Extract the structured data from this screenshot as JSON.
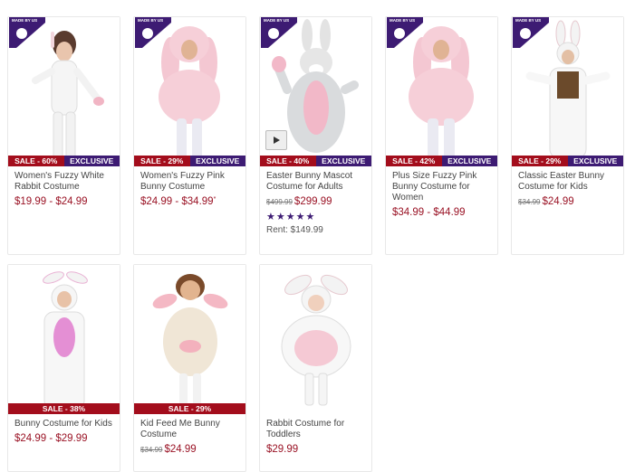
{
  "products": [
    {
      "title": "Women's Fuzzy White Rabbit Costume",
      "sale": "SALE - 60%",
      "exclusive": "EXCLUSIVE",
      "old_price": "",
      "price": "$19.99 - $24.99",
      "made_by_us": "MADE BY US"
    },
    {
      "title": "Women's Fuzzy Pink Bunny Costume",
      "sale": "SALE - 29%",
      "exclusive": "EXCLUSIVE",
      "old_price": "",
      "price": "$24.99 - $34.99",
      "price_mark": "*",
      "made_by_us": "MADE BY US"
    },
    {
      "title": "Easter Bunny Mascot Costume for Adults",
      "sale": "SALE - 40%",
      "exclusive": "EXCLUSIVE",
      "old_price": "$499.99",
      "price": "$299.99",
      "rating": "★★★★★",
      "rent": "Rent: $149.99",
      "made_by_us": "MADE BY US"
    },
    {
      "title": "Plus Size Fuzzy Pink Bunny Costume for Women",
      "sale": "SALE - 42%",
      "exclusive": "EXCLUSIVE",
      "old_price": "",
      "price": "$34.99 - $44.99",
      "made_by_us": "MADE BY US"
    },
    {
      "title": "Classic Easter Bunny Costume for Kids",
      "sale": "SALE - 29%",
      "exclusive": "EXCLUSIVE",
      "old_price": "$34.99",
      "price": "$24.99",
      "made_by_us": "MADE BY US"
    },
    {
      "title": "Bunny Costume for Kids",
      "sale": "SALE - 38%",
      "old_price": "",
      "price": "$24.99 - $29.99"
    },
    {
      "title": "Kid Feed Me Bunny Costume",
      "sale": "SALE - 29%",
      "old_price": "$34.99",
      "price": "$24.99"
    },
    {
      "title": "Rabbit Costume for Toddlers",
      "old_price": "",
      "price": "$29.99"
    }
  ]
}
